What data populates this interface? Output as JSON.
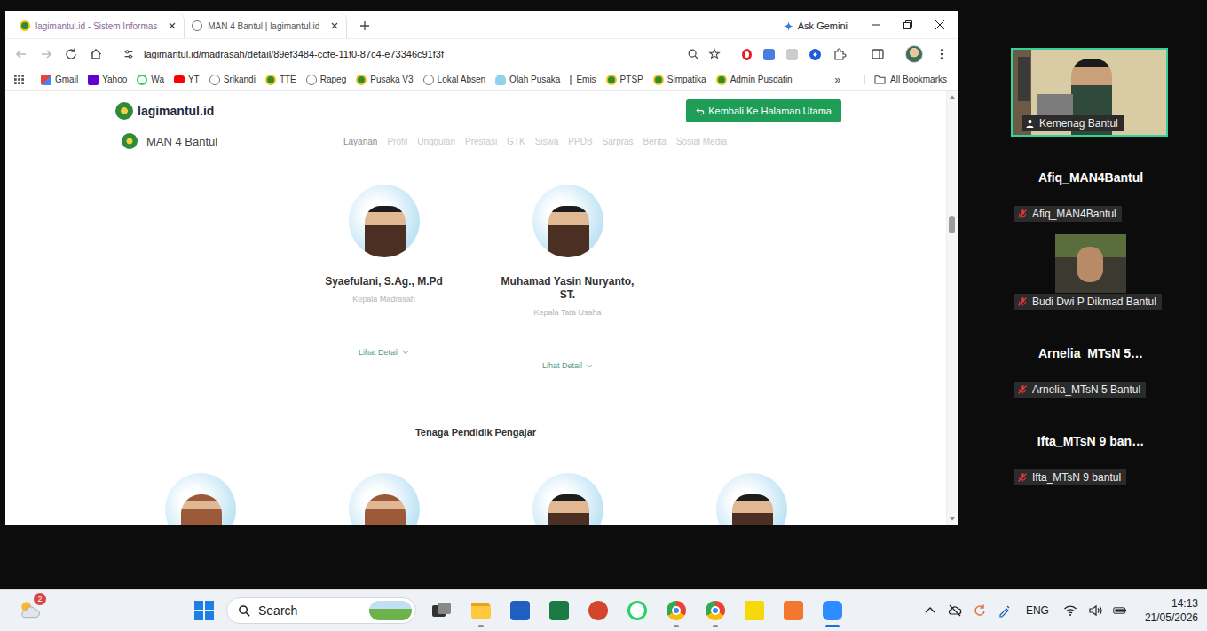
{
  "browser": {
    "tabs": [
      {
        "label": "lagimantul.id - Sistem Informas",
        "selected": true,
        "kind": "emblem"
      },
      {
        "label": "MAN 4 Bantul | lagimantul.id",
        "selected": false,
        "kind": "globe"
      }
    ],
    "ask_button": "Ask Gemini",
    "url": "lagimantul.id/madrasah/detail/89ef3484-ccfe-11f0-87c4-e73346c91f3f",
    "bookmarks": [
      {
        "label": "Gmail",
        "kind": "gmail"
      },
      {
        "label": "Yahoo",
        "kind": "yahoo"
      },
      {
        "label": "Wa",
        "kind": "wa"
      },
      {
        "label": "YT",
        "kind": "yt"
      },
      {
        "label": "Srikandi",
        "kind": "globe"
      },
      {
        "label": "TTE",
        "kind": "emblem"
      },
      {
        "label": "Rapeg",
        "kind": "globe"
      },
      {
        "label": "Pusaka V3",
        "kind": "emblem"
      },
      {
        "label": "Lokal Absen",
        "kind": "globe"
      },
      {
        "label": "Olah Pusaka",
        "kind": "cloud"
      },
      {
        "label": "Emis",
        "kind": "doc"
      },
      {
        "label": "PTSP",
        "kind": "emblem"
      },
      {
        "label": "Simpatika",
        "kind": "emblem"
      },
      {
        "label": "Admin Pusdatin",
        "kind": "emblem"
      }
    ],
    "bookmarks_more": "»",
    "all_bookmarks": "All Bookmarks"
  },
  "page": {
    "site_name": "lagimantul.id",
    "back_button": "Kembali Ke Halaman Utama",
    "school": "MAN 4 Bantul",
    "nav": [
      {
        "label": "Layanan",
        "selected": true
      },
      {
        "label": "Profil",
        "selected": false
      },
      {
        "label": "Unggulan",
        "selected": false
      },
      {
        "label": "Prestasi",
        "selected": false
      },
      {
        "label": "GTK",
        "selected": false
      },
      {
        "label": "Siswa",
        "selected": false
      },
      {
        "label": "PPDB",
        "selected": false
      },
      {
        "label": "Sarpras",
        "selected": false
      },
      {
        "label": "Berita",
        "selected": false
      },
      {
        "label": "Sosial Media",
        "selected": false
      }
    ],
    "leaders": [
      {
        "name": "Syaefulani, S.Ag., M.Pd",
        "role": "Kepala Madrasah",
        "link": "Lihat Detail"
      },
      {
        "name": "Muhamad Yasin Nuryanto, ST.",
        "role": "Kepala Tata Usaha",
        "link": "Lihat Detail"
      }
    ],
    "teachers_heading": "Tenaga Pendidik Pengajar",
    "teachers": [
      {
        "kind": "hijab"
      },
      {
        "kind": "hijab"
      },
      {
        "kind": "peci"
      },
      {
        "kind": "peci"
      }
    ],
    "scroll_level": 0.29
  },
  "zoom": {
    "participants": [
      {
        "kind": "video",
        "name": "",
        "label": "Kemenag Bantul",
        "muted": false,
        "selected": true
      },
      {
        "kind": "name",
        "name": "Afiq_MAN4Bantul",
        "label": "Afiq_MAN4Bantul",
        "muted": true,
        "selected": false
      },
      {
        "kind": "avatar",
        "name": "",
        "label": "Budi Dwi P Dikmad Bantul",
        "muted": true,
        "selected": false
      },
      {
        "kind": "name",
        "name": "Arnelia_MTsN 5…",
        "label": "Arnelia_MTsN 5 Bantul",
        "muted": true,
        "selected": false
      },
      {
        "kind": "name",
        "name": "Ifta_MTsN 9 ban…",
        "label": "Ifta_MTsN 9 bantul",
        "muted": true,
        "selected": false
      }
    ]
  },
  "taskbar": {
    "weather_badge": "2",
    "search_placeholder": "Search",
    "apps": [
      {
        "kind": "taskview",
        "running": false,
        "selected": false
      },
      {
        "kind": "explorer",
        "running": true,
        "selected": false
      },
      {
        "kind": "word",
        "running": false,
        "selected": false
      },
      {
        "kind": "excel",
        "running": false,
        "selected": false
      },
      {
        "kind": "powerpoint",
        "running": false,
        "selected": false
      },
      {
        "kind": "whatsapp",
        "running": false,
        "selected": false
      },
      {
        "kind": "chrome",
        "running": true,
        "selected": false
      },
      {
        "kind": "chrome",
        "running": true,
        "selected": false
      },
      {
        "kind": "notes",
        "running": false,
        "selected": false
      },
      {
        "kind": "sublime",
        "running": false,
        "selected": false
      },
      {
        "kind": "zoom",
        "running": true,
        "selected": true
      }
    ],
    "language": "ENG",
    "time": "14:13",
    "date": "21/05/2026"
  }
}
